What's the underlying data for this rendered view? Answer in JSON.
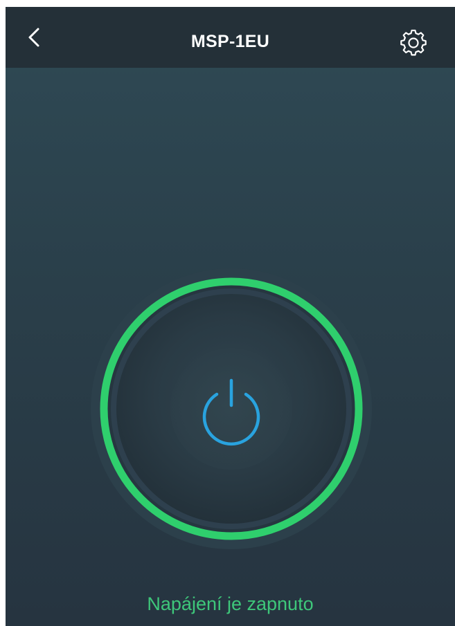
{
  "header": {
    "title": "MSP-1EU",
    "back_icon": "chevron-left-icon",
    "settings_icon": "gear-icon"
  },
  "power": {
    "icon": "power-icon",
    "state_on": true,
    "ring_color": "#2fcf6d",
    "icon_color": "#29a3df"
  },
  "status": {
    "text": "Napájení je zapnuto",
    "color": "#3ec77a"
  },
  "colors": {
    "navbar": "#243038",
    "background": "#2c434e"
  }
}
